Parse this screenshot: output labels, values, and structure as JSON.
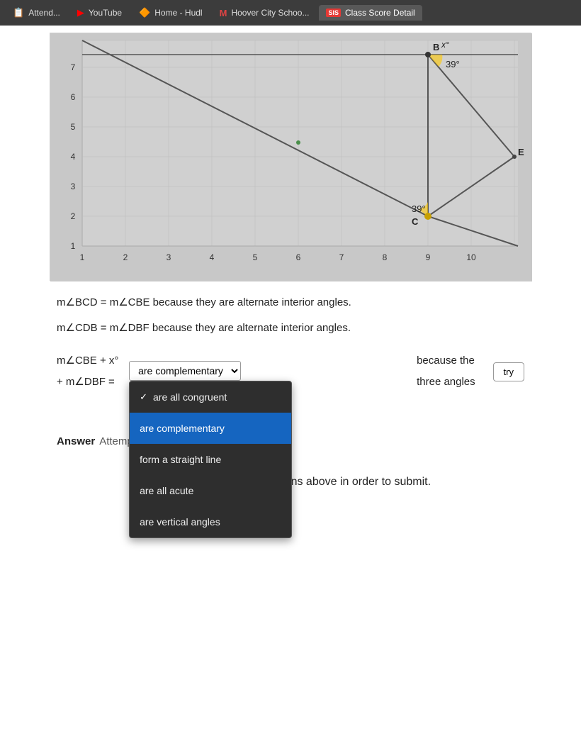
{
  "tabs": [
    {
      "id": "attend",
      "label": "Attend...",
      "icon": "📋",
      "active": false
    },
    {
      "id": "youtube",
      "label": "YouTube",
      "icon": "▶",
      "active": false
    },
    {
      "id": "hudl",
      "label": "Home - Hudl",
      "icon": "🔶",
      "active": false
    },
    {
      "id": "hoover",
      "label": "Hoover City Schoo...",
      "icon": "M",
      "active": false
    },
    {
      "id": "sis",
      "label": "Class Score Detail",
      "badge": "SIS",
      "active": true
    }
  ],
  "graph": {
    "xLabels": [
      "1",
      "2",
      "3",
      "4",
      "5",
      "6",
      "7",
      "8",
      "9",
      "10"
    ],
    "yLabels": [
      "1",
      "2",
      "3",
      "4",
      "5",
      "6",
      "7"
    ],
    "pointB_label": "B",
    "pointC_label": "C",
    "pointE_label": "E",
    "angle1_label": "x°",
    "angle2_label": "39°",
    "angle3_label": "39°"
  },
  "math_lines": [
    {
      "id": "line1",
      "text": "m∠BCD = m∠CBE because they are alternate interior angles."
    },
    {
      "id": "line2",
      "text": "m∠CDB = m∠DBF because they are alternate interior angles."
    }
  ],
  "dropdown_row": {
    "prefix": "m∠CBE + x° + m∠DBF =",
    "placeholder": "",
    "suffix": "because the three angles"
  },
  "dropdown_options": [
    {
      "id": "opt1",
      "label": "are all congruent",
      "selected": false,
      "checked": true
    },
    {
      "id": "opt2",
      "label": "are complementary",
      "selected": true,
      "checked": false
    },
    {
      "id": "opt3",
      "label": "form a straight line",
      "selected": false,
      "checked": false
    },
    {
      "id": "opt4",
      "label": "are all acute",
      "selected": false,
      "checked": false
    },
    {
      "id": "opt5",
      "label": "are vertical angles",
      "selected": false,
      "checked": false
    }
  ],
  "try_button": "try",
  "answer_section": {
    "label": "Answer",
    "attempt_text": "Attempt..."
  },
  "bottom_note": "You must answer all questions above in order to submit."
}
